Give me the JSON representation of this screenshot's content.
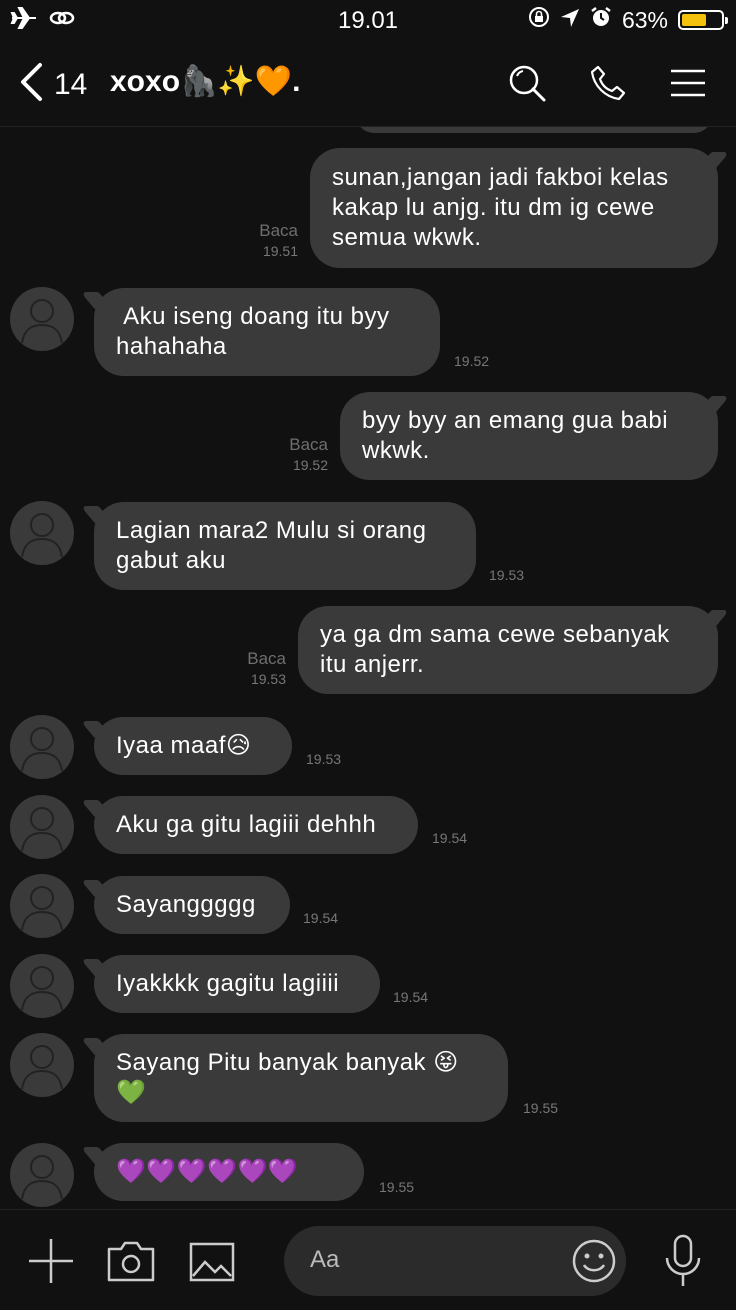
{
  "status": {
    "time": "19.01",
    "battery": "63%",
    "battery_level": 0.63
  },
  "header": {
    "back_count": "14",
    "title": "xoxo🦍✨🧡."
  },
  "messages": [
    {
      "text": "sunan,jangan jadi fakboi kelas\nkakap lu anjg. itu dm ig cewe\nsemua wkwk.",
      "read": "Baca",
      "time": "19.51"
    },
    {
      "text": " Aku iseng doang itu byy\nhahahaha",
      "time": "19.52"
    },
    {
      "text": "byy byy an emang gua babi\nwkwk.",
      "read": "Baca",
      "time": "19.52"
    },
    {
      "text": "Lagian mara2 Mulu si orang\ngabut aku",
      "time": "19.53"
    },
    {
      "text": "ya ga dm sama cewe sebanyak\nitu anjerr.",
      "read": "Baca",
      "time": "19.53"
    },
    {
      "text": "Iyaa maaf😥",
      "time": "19.53"
    },
    {
      "text": "Aku ga gitu lagiii dehhh",
      "time": "19.54"
    },
    {
      "text": "Sayanggggg",
      "time": "19.54"
    },
    {
      "text": "Iyakkkk gagitu lagiiii",
      "time": "19.54"
    },
    {
      "text": "Sayang Pitu banyak banyak 😝\n💚",
      "time": "19.55"
    },
    {
      "text": "💜💜💜💜💜💜",
      "time": "19.55"
    }
  ],
  "composer": {
    "placeholder": "Aa"
  }
}
